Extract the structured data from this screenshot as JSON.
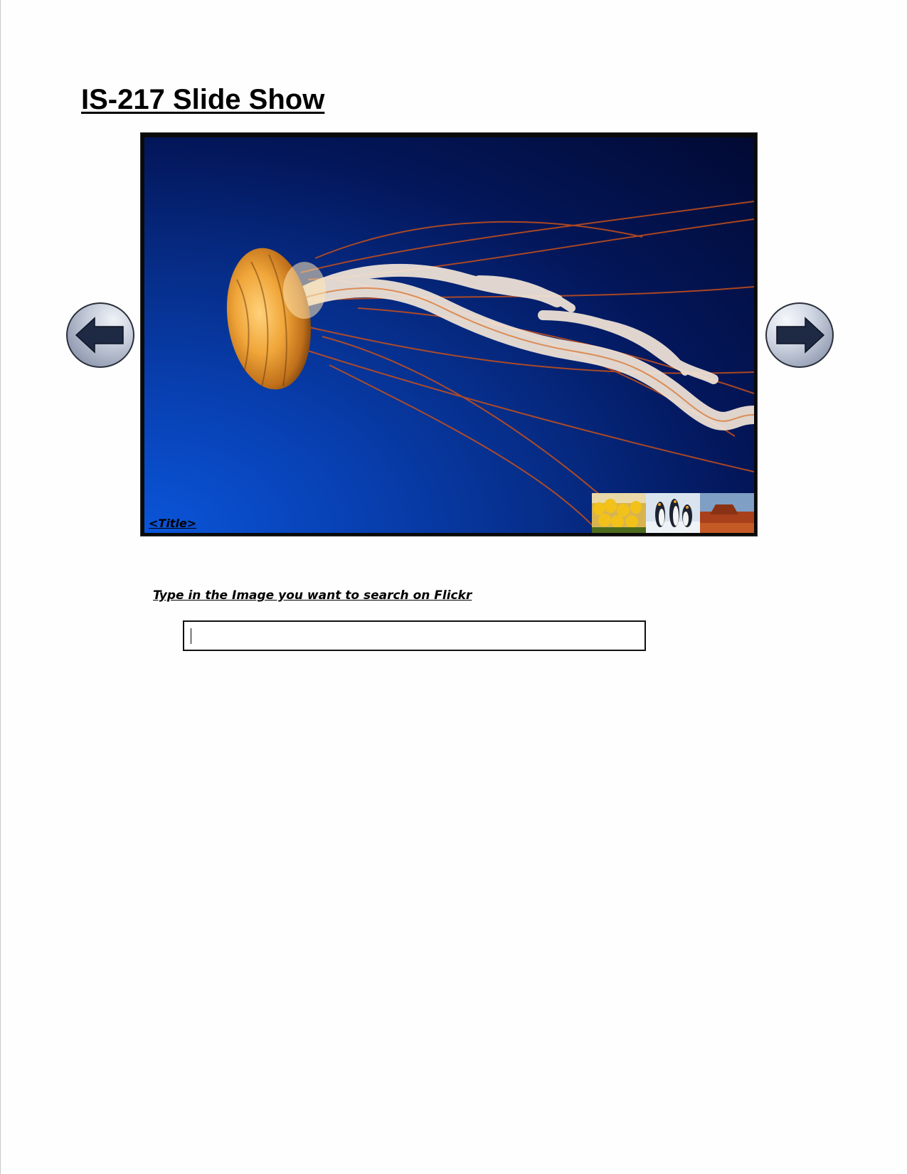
{
  "page": {
    "title": "IS-217 Slide Show"
  },
  "slideshow": {
    "current_slide_title": "<Title>",
    "thumbnails": [
      {
        "name": "tulips"
      },
      {
        "name": "penguins"
      },
      {
        "name": "desert"
      }
    ],
    "prev_icon": "arrow-left-icon",
    "next_icon": "arrow-right-icon"
  },
  "search": {
    "label": "Type in the Image you want to search on Flickr",
    "value": "",
    "placeholder": ""
  },
  "colors": {
    "slide_background": "#062c86",
    "button_face": "#c4cbd9",
    "arrow_fill": "#1e2a44"
  }
}
